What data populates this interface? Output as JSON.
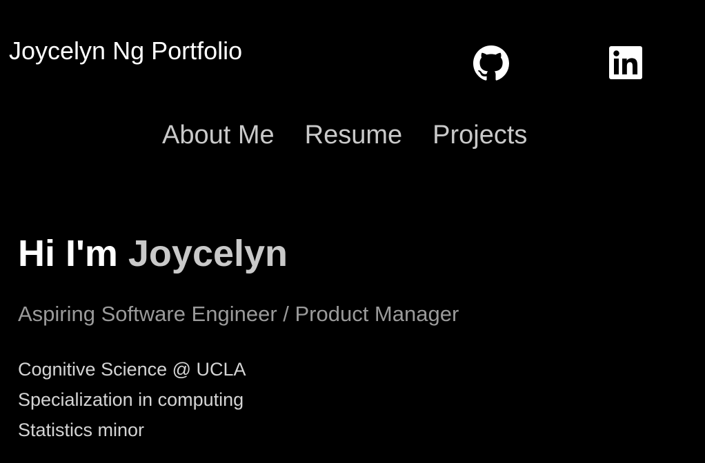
{
  "header": {
    "site_title": "Joycelyn Ng Portfolio",
    "social": [
      {
        "name": "github",
        "icon": "github-icon"
      },
      {
        "name": "linkedin",
        "icon": "linkedin-icon"
      }
    ]
  },
  "nav": {
    "items": [
      {
        "label": "About Me"
      },
      {
        "label": "Resume"
      },
      {
        "label": "Projects"
      }
    ]
  },
  "hero": {
    "greeting": "Hi I'm",
    "name": "Joycelyn",
    "tagline": "Aspiring Software Engineer / Product Manager",
    "details": [
      "Cognitive Science @ UCLA",
      "Specialization in computing",
      "Statistics minor"
    ]
  },
  "colors": {
    "background": "#000000",
    "primary_text": "#ffffff",
    "nav_text": "#c9c9c9",
    "tagline_text": "#9a9a9a"
  }
}
